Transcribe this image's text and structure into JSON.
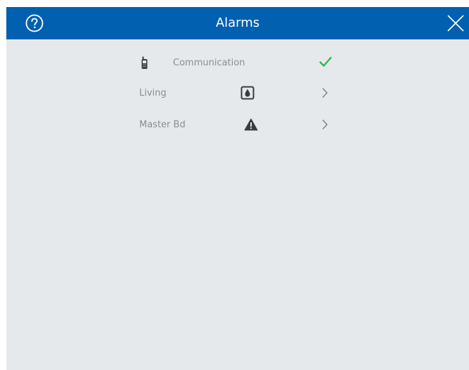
{
  "header": {
    "title": "Alarms",
    "help_icon": "help-circle-icon",
    "close_icon": "close-icon",
    "background_color": "#0160b0"
  },
  "rows": [
    {
      "label": "Communication",
      "icon": "phone-icon",
      "status_icon": "checkmark-icon",
      "status_color": "#2db84a"
    },
    {
      "label": "Living",
      "icon": "water-drop-icon",
      "status_icon": "chevron-right-icon"
    },
    {
      "label": "Master Bd",
      "icon": "warning-icon",
      "status_icon": "chevron-right-icon"
    }
  ],
  "colors": {
    "content_background": "#e6e9ec",
    "label_text": "#8b8e91",
    "icon_dark": "#3a3d40"
  }
}
